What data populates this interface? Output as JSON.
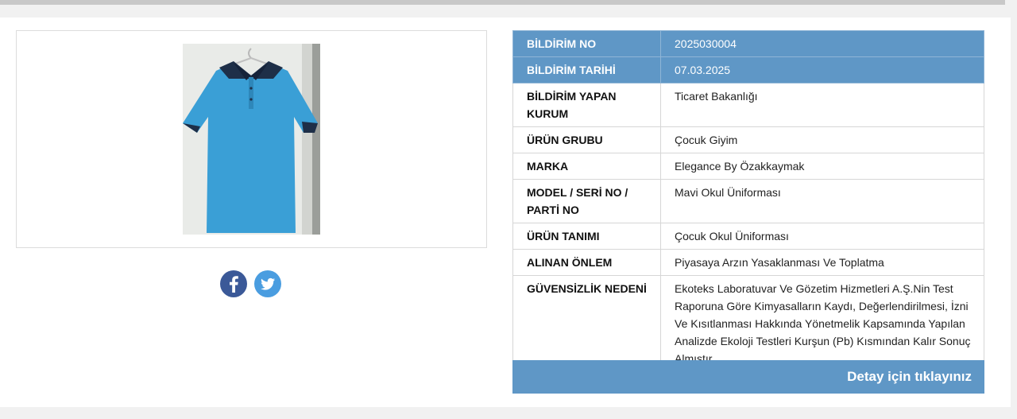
{
  "product": {
    "image_alt": "Mavi çocuk polo tişört (okul üniforması)",
    "colors": {
      "shirt": "#3a9fd6",
      "collar": "#1e2f48",
      "accent": "#5f97c6"
    }
  },
  "share": {
    "facebook_icon": "facebook-icon",
    "twitter_icon": "twitter-icon"
  },
  "table": {
    "rows": [
      {
        "label": "BİLDİRİM NO",
        "value": "2025030004"
      },
      {
        "label": "BİLDİRİM TARİHİ",
        "value": "07.03.2025"
      },
      {
        "label": "BİLDİRİM YAPAN KURUM",
        "value": "Ticaret Bakanlığı"
      },
      {
        "label": "ÜRÜN GRUBU",
        "value": "Çocuk Giyim"
      },
      {
        "label": "MARKA",
        "value": "Elegance By Özakkaymak"
      },
      {
        "label": "MODEL / SERİ NO / PARTİ NO",
        "value": "Mavi Okul Üniforması"
      },
      {
        "label": "ÜRÜN TANIMI",
        "value": "Çocuk Okul Üniforması"
      },
      {
        "label": "ALINAN ÖNLEM",
        "value": "Piyasaya Arzın Yasaklanması Ve Toplatma"
      },
      {
        "label": "GÜVENSİZLİK NEDENİ",
        "value": "Ekoteks Laboratuvar Ve Gözetim Hizmetleri A.Ş.Nin Test Raporuna Göre Kimyasalların Kaydı, Değerlendirilmesi, İzni Ve Kısıtlanması Hakkında Yönetmelik Kapsamında Yapılan Analizde Ekoloji Testleri Kurşun (Pb) Kısmından Kalır Sonuç Almıştır."
      }
    ]
  },
  "detail_link": "Detay için tıklayınız"
}
